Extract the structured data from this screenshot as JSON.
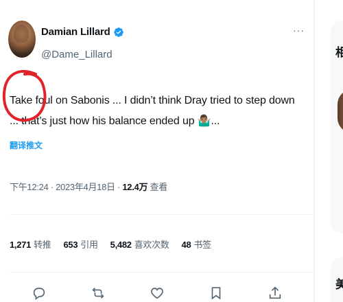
{
  "tweet": {
    "author_name": "Damian Lillard",
    "author_handle": "@Dame_Lillard",
    "more_label": "···",
    "text": "Take foul on Sabonis ... I didn’t think Dray tried to step down ... that’s just how his balance ended up 🤷🏽‍♂️...",
    "translate_label": "翻译推文",
    "time": "下午12:24",
    "date": "2023年4月18日",
    "views_count": "12.4万",
    "views_label": "查看",
    "separator": " · "
  },
  "stats": [
    {
      "count": "1,271",
      "label": "转推"
    },
    {
      "count": "653",
      "label": "引用"
    },
    {
      "count": "5,482",
      "label": "喜欢次数"
    },
    {
      "count": "48",
      "label": "书签"
    }
  ],
  "actions": [
    {
      "icon": "reply-icon"
    },
    {
      "icon": "retweet-icon"
    },
    {
      "icon": "like-icon"
    },
    {
      "icon": "bookmark-icon"
    },
    {
      "icon": "share-icon"
    }
  ],
  "right_panel": {
    "section1_title": "相",
    "section2_title": "美"
  },
  "colors": {
    "accent": "#1d9bf0",
    "text_primary": "#0f1419",
    "text_secondary": "#536471",
    "annotation": "#e0242a"
  }
}
